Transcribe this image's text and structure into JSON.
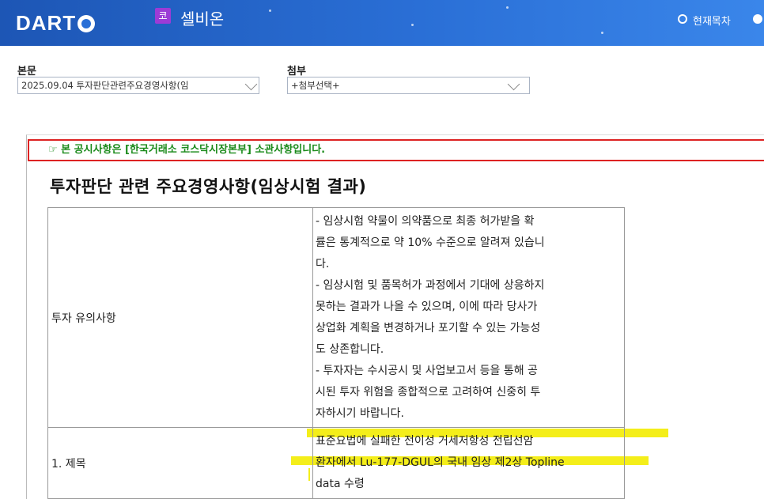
{
  "header": {
    "logo_text": "DART",
    "company_badge": "코",
    "company_name": "셀비온",
    "toc_label": "현재목차",
    "brand_color": "#2a6fd6"
  },
  "selectors": {
    "main_label": "본문",
    "main_value": "2025.09.04  투자판단관련주요경영사항(임",
    "attach_label": "첨부",
    "attach_value": "+첨부선택+"
  },
  "document": {
    "notice": "☞ 본 공시사항은 [한국거래소 코스닥시장본부] 소관사항입니다.",
    "title": "투자판단 관련 주요경영사항(임상시험 결과)",
    "rows": [
      {
        "label": "투자 유의사항",
        "lines": [
          "- 임상시험 약물이 의약품으로 최종 허가받을 확",
          "률은 통계적으로 약 10% 수준으로 알려져 있습니",
          "다.",
          "- 임상시험 및 품목허가 과정에서 기대에 상응하지",
          "못하는 결과가 나올 수 있으며, 이에 따라 당사가",
          "상업화 계획을 변경하거나 포기할 수 있는 가능성",
          "도 상존합니다.",
          "- 투자자는 수시공시 및 사업보고서 등을 통해 공",
          "시된 투자 위험을 종합적으로 고려하여 신중히 투",
          "자하시기 바랍니다."
        ]
      },
      {
        "label": "1. 제목",
        "lines": [
          "표준요법에 실패한 전이성 거세저항성 전립선암",
          "환자에서 Lu-177-DGUL의 국내 임상 제2상 Topline",
          "data 수령"
        ]
      }
    ]
  }
}
